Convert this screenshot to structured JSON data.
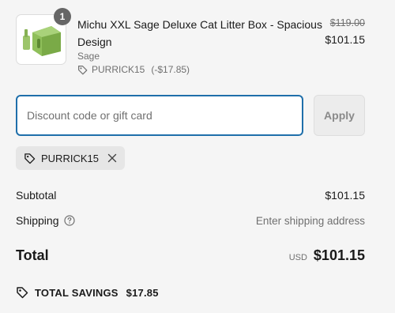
{
  "product": {
    "quantity": "1",
    "name": "Michu XXL Sage Deluxe Cat Litter Box - Spacious Design",
    "variant": "Sage",
    "discount_code": "PURRICK15",
    "discount_amount": "(-$17.85)",
    "original_price": "$119.00",
    "price": "$101.15",
    "image_icon": "litter-box-image"
  },
  "discount": {
    "placeholder": "Discount code or gift card",
    "value": "",
    "apply_label": "Apply",
    "applied_code": "PURRICK15"
  },
  "summary": {
    "subtotal_label": "Subtotal",
    "subtotal_value": "$101.15",
    "shipping_label": "Shipping",
    "shipping_value": "Enter shipping address",
    "total_label": "Total",
    "currency": "USD",
    "total_value": "$101.15",
    "savings_label": "TOTAL SAVINGS",
    "savings_value": "$17.85"
  },
  "colors": {
    "focus_border": "#1f6faa",
    "background": "#f5f5f5",
    "product_green": "#8fbf5a"
  }
}
